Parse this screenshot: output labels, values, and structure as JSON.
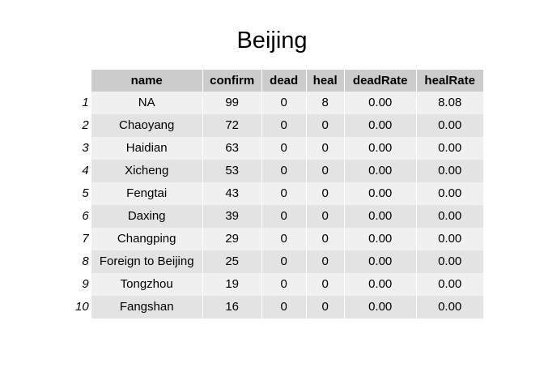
{
  "chart_data": {
    "type": "table",
    "title": "Beijing",
    "columns": [
      "name",
      "confirm",
      "dead",
      "heal",
      "deadRate",
      "healRate"
    ],
    "row_labels": [
      "1",
      "2",
      "3",
      "4",
      "5",
      "6",
      "7",
      "8",
      "9",
      "10"
    ],
    "rows": [
      [
        "NA",
        "99",
        "0",
        "8",
        "0.00",
        "8.08"
      ],
      [
        "Chaoyang",
        "72",
        "0",
        "0",
        "0.00",
        "0.00"
      ],
      [
        "Haidian",
        "63",
        "0",
        "0",
        "0.00",
        "0.00"
      ],
      [
        "Xicheng",
        "53",
        "0",
        "0",
        "0.00",
        "0.00"
      ],
      [
        "Fengtai",
        "43",
        "0",
        "0",
        "0.00",
        "0.00"
      ],
      [
        "Daxing",
        "39",
        "0",
        "0",
        "0.00",
        "0.00"
      ],
      [
        "Changping",
        "29",
        "0",
        "0",
        "0.00",
        "0.00"
      ],
      [
        "Foreign to Beijing",
        "25",
        "0",
        "0",
        "0.00",
        "0.00"
      ],
      [
        "Tongzhou",
        "19",
        "0",
        "0",
        "0.00",
        "0.00"
      ],
      [
        "Fangshan",
        "16",
        "0",
        "0",
        "0.00",
        "0.00"
      ]
    ]
  }
}
